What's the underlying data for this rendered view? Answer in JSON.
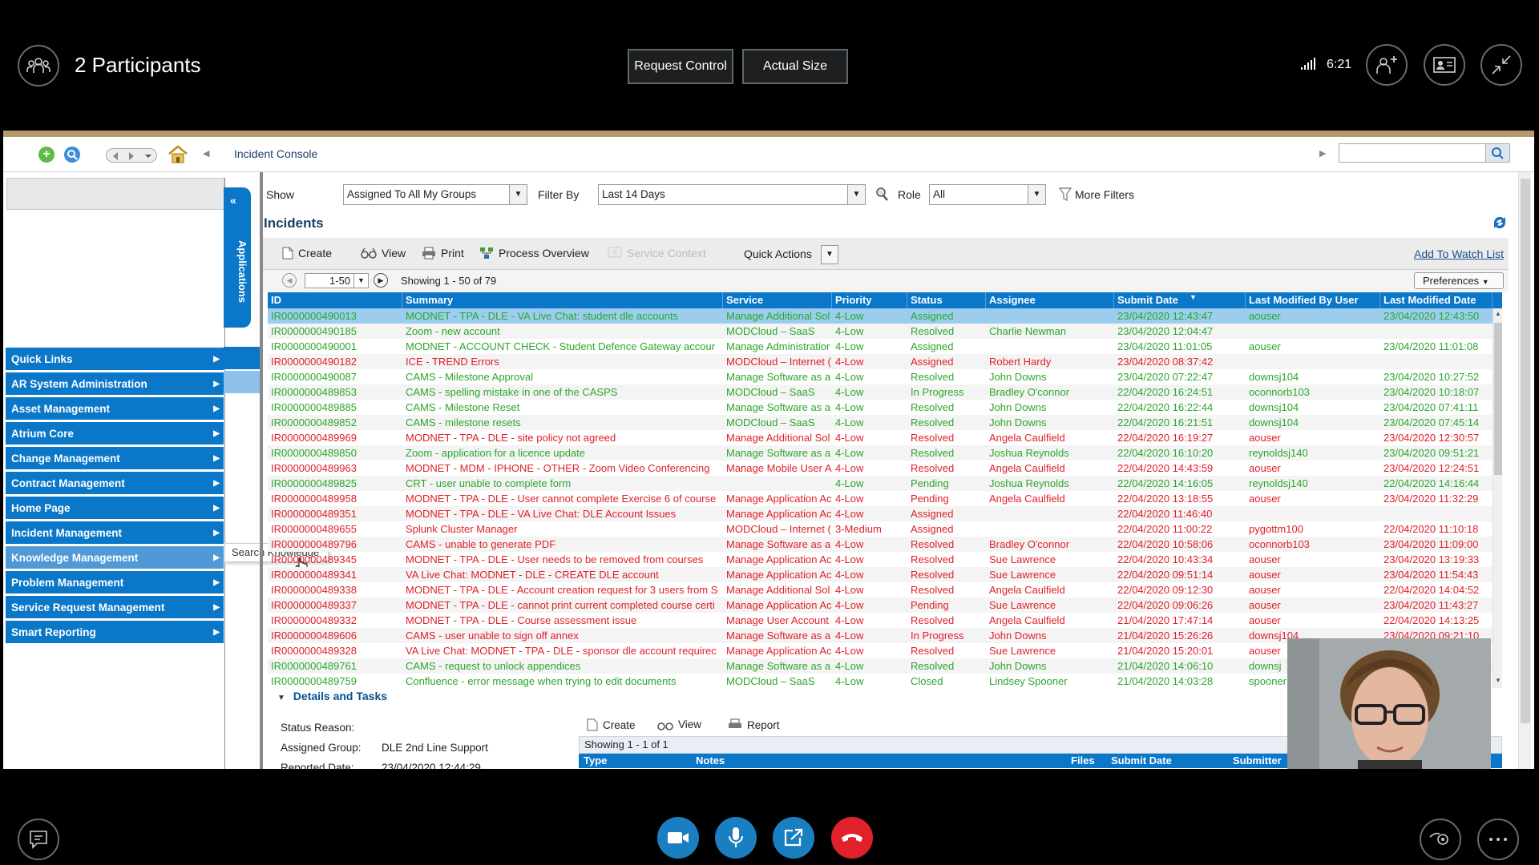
{
  "call": {
    "participants_label": "2 Participants",
    "request_control": "Request Control",
    "actual_size": "Actual Size",
    "time": "6:21"
  },
  "app": {
    "title": "Incident Console",
    "show_label": "Show",
    "show_value": "Assigned To All My Groups",
    "filter_by_label": "Filter By",
    "filter_by_value": "Last 14 Days",
    "role_label": "Role",
    "role_value": "All",
    "more_filters": "More Filters",
    "section_title": "Incidents",
    "add_to_watch": "Add To Watch List",
    "preferences": "Preferences",
    "page_range": "1-50",
    "showing": "Showing 1 - 50 of 79",
    "applications_tab": "Applications"
  },
  "toolbar": {
    "create": "Create",
    "view": "View",
    "print": "Print",
    "process_overview": "Process Overview",
    "service_context": "Service Context",
    "quick_actions": "Quick Actions"
  },
  "nav": {
    "items": [
      "Quick Links",
      "AR System Administration",
      "Asset Management",
      "Atrium Core",
      "Change Management",
      "Contract Management",
      "Home Page",
      "Incident Management",
      "Knowledge Management",
      "Problem Management",
      "Service Request Management",
      "Smart Reporting"
    ],
    "flyout": "Search Knowledge"
  },
  "grid": {
    "columns": [
      "ID",
      "Summary",
      "Service",
      "Priority",
      "Status",
      "Assignee",
      "Submit Date",
      "Last Modified By User",
      "Last Modified Date"
    ],
    "rows": [
      {
        "id": "IR0000000490013",
        "summary": "MODNET - TPA - DLE - VA Live Chat: student dle accounts",
        "service": "Manage Additional Sol",
        "priority": "4-Low",
        "status": "Assigned",
        "assignee": "",
        "submit": "23/04/2020 12:43:47",
        "modby": "aouser",
        "moddate": "23/04/2020 12:43:50",
        "color": "green"
      },
      {
        "id": "IR0000000490185",
        "summary": "Zoom - new account",
        "service": "MODCloud – SaaS",
        "priority": "4-Low",
        "status": "Resolved",
        "assignee": "Charlie Newman",
        "submit": "23/04/2020 12:04:47",
        "modby": "",
        "moddate": "",
        "color": "green"
      },
      {
        "id": "IR0000000490001",
        "summary": "MODNET - ACCOUNT CHECK - Student Defence Gateway accour",
        "service": "Manage Administratior",
        "priority": "4-Low",
        "status": "Assigned",
        "assignee": "",
        "submit": "23/04/2020 11:01:05",
        "modby": "aouser",
        "moddate": "23/04/2020 11:01:08",
        "color": "green"
      },
      {
        "id": "IR0000000490182",
        "summary": "ICE - TREND Errors",
        "service": "MODCloud – Internet (",
        "priority": "4-Low",
        "status": "Assigned",
        "assignee": "Robert Hardy",
        "submit": "23/04/2020 08:37:42",
        "modby": "",
        "moddate": "",
        "color": "red"
      },
      {
        "id": "IR0000000490087",
        "summary": "CAMS - Milestone Approval",
        "service": "Manage Software as a",
        "priority": "4-Low",
        "status": "Resolved",
        "assignee": "John Downs",
        "submit": "23/04/2020 07:22:47",
        "modby": "downsj104",
        "moddate": "23/04/2020 10:27:52",
        "color": "green"
      },
      {
        "id": "IR0000000489853",
        "summary": "CAMS - spelling mistake in one of the CASPS",
        "service": "MODCloud – SaaS",
        "priority": "4-Low",
        "status": "In Progress",
        "assignee": "Bradley O'connor",
        "submit": "22/04/2020 16:24:51",
        "modby": "oconnorb103",
        "moddate": "23/04/2020 10:18:07",
        "color": "green"
      },
      {
        "id": "IR0000000489885",
        "summary": "CAMS - Milestone Reset",
        "service": "Manage Software as a",
        "priority": "4-Low",
        "status": "Resolved",
        "assignee": "John Downs",
        "submit": "22/04/2020 16:22:44",
        "modby": "downsj104",
        "moddate": "23/04/2020 07:41:11",
        "color": "green"
      },
      {
        "id": "IR0000000489852",
        "summary": "CAMS - milestone resets",
        "service": "MODCloud – SaaS",
        "priority": "4-Low",
        "status": "Resolved",
        "assignee": "John Downs",
        "submit": "22/04/2020 16:21:51",
        "modby": "downsj104",
        "moddate": "23/04/2020 07:45:14",
        "color": "green"
      },
      {
        "id": "IR0000000489969",
        "summary": "MODNET - TPA - DLE - site policy not agreed",
        "service": "Manage Additional Sol",
        "priority": "4-Low",
        "status": "Resolved",
        "assignee": "Angela Caulfield",
        "submit": "22/04/2020 16:19:27",
        "modby": "aouser",
        "moddate": "23/04/2020 12:30:57",
        "color": "red"
      },
      {
        "id": "IR0000000489850",
        "summary": "Zoom - application for a licence update",
        "service": "Manage Software as a",
        "priority": "4-Low",
        "status": "Resolved",
        "assignee": "Joshua Reynolds",
        "submit": "22/04/2020 16:10:20",
        "modby": "reynoldsj140",
        "moddate": "23/04/2020 09:51:21",
        "color": "green"
      },
      {
        "id": "IR0000000489963",
        "summary": "MODNET - MDM - IPHONE - OTHER - Zoom Video Conferencing",
        "service": "Manage Mobile User A",
        "priority": "4-Low",
        "status": "Resolved",
        "assignee": "Angela Caulfield",
        "submit": "22/04/2020 14:43:59",
        "modby": "aouser",
        "moddate": "23/04/2020 12:24:51",
        "color": "red"
      },
      {
        "id": "IR0000000489825",
        "summary": "CRT - user unable to complete form",
        "service": "",
        "priority": "4-Low",
        "status": "Pending",
        "assignee": "Joshua Reynolds",
        "submit": "22/04/2020 14:16:05",
        "modby": "reynoldsj140",
        "moddate": "22/04/2020 14:16:44",
        "color": "green"
      },
      {
        "id": "IR0000000489958",
        "summary": "MODNET - TPA - DLE - User cannot complete Exercise 6 of course",
        "service": "Manage Application Ac",
        "priority": "4-Low",
        "status": "Pending",
        "assignee": "Angela Caulfield",
        "submit": "22/04/2020 13:18:55",
        "modby": "aouser",
        "moddate": "23/04/2020 11:32:29",
        "color": "red"
      },
      {
        "id": "IR0000000489351",
        "summary": "MODNET - TPA - DLE - VA Live Chat: DLE Account Issues",
        "service": "Manage Application Ac",
        "priority": "4-Low",
        "status": "Assigned",
        "assignee": "",
        "submit": "22/04/2020 11:46:40",
        "modby": "",
        "moddate": "",
        "color": "red"
      },
      {
        "id": "IR0000000489655",
        "summary": "Splunk Cluster Manager",
        "service": "MODCloud – Internet (",
        "priority": "3-Medium",
        "status": "Assigned",
        "assignee": "",
        "submit": "22/04/2020 11:00:22",
        "modby": "pygottm100",
        "moddate": "22/04/2020 11:10:18",
        "color": "red"
      },
      {
        "id": "IR0000000489796",
        "summary": "CAMS - unable to generate PDF",
        "service": "Manage Software as a",
        "priority": "4-Low",
        "status": "Resolved",
        "assignee": "Bradley O'connor",
        "submit": "22/04/2020 10:58:06",
        "modby": "oconnorb103",
        "moddate": "23/04/2020 11:09:00",
        "color": "red"
      },
      {
        "id": "IR0000000489345",
        "summary": "MODNET - TPA - DLE - User needs to be removed from courses",
        "service": "Manage Application Ac",
        "priority": "4-Low",
        "status": "Resolved",
        "assignee": "Sue Lawrence",
        "submit": "22/04/2020 10:43:34",
        "modby": "aouser",
        "moddate": "23/04/2020 13:19:33",
        "color": "red"
      },
      {
        "id": "IR0000000489341",
        "summary": "VA Live Chat: MODNET - DLE - CREATE DLE account",
        "service": "Manage Application Ac",
        "priority": "4-Low",
        "status": "Resolved",
        "assignee": "Sue Lawrence",
        "submit": "22/04/2020 09:51:14",
        "modby": "aouser",
        "moddate": "23/04/2020 11:54:43",
        "color": "red"
      },
      {
        "id": "IR0000000489338",
        "summary": "MODNET - TPA - DLE - Account creation request for 3 users from S",
        "service": "Manage Additional Sol",
        "priority": "4-Low",
        "status": "Resolved",
        "assignee": "Angela Caulfield",
        "submit": "22/04/2020 09:12:30",
        "modby": "aouser",
        "moddate": "22/04/2020 14:04:52",
        "color": "red"
      },
      {
        "id": "IR0000000489337",
        "summary": "MODNET - TPA - DLE - cannot print current completed course certi",
        "service": "Manage Application Ac",
        "priority": "4-Low",
        "status": "Pending",
        "assignee": "Sue Lawrence",
        "submit": "22/04/2020 09:06:26",
        "modby": "aouser",
        "moddate": "23/04/2020 11:43:27",
        "color": "red"
      },
      {
        "id": "IR0000000489332",
        "summary": "MODNET - TPA - DLE - Course assessment issue",
        "service": "Manage User Account",
        "priority": "4-Low",
        "status": "Resolved",
        "assignee": "Angela Caulfield",
        "submit": "21/04/2020 17:47:14",
        "modby": "aouser",
        "moddate": "22/04/2020 14:13:25",
        "color": "red"
      },
      {
        "id": "IR0000000489606",
        "summary": "CAMS - user unable to sign off annex",
        "service": "Manage Software as a",
        "priority": "4-Low",
        "status": "In Progress",
        "assignee": "John Downs",
        "submit": "21/04/2020 15:26:26",
        "modby": "downsj104",
        "moddate": "23/04/2020 09:21:10",
        "color": "red"
      },
      {
        "id": "IR0000000489328",
        "summary": "VA Live Chat: MODNET - TPA - DLE - sponsor dle account requirec",
        "service": "Manage Application Ac",
        "priority": "4-Low",
        "status": "Resolved",
        "assignee": "Sue Lawrence",
        "submit": "21/04/2020 15:20:01",
        "modby": "aouser",
        "moddate": "",
        "color": "red"
      },
      {
        "id": "IR0000000489761",
        "summary": "CAMS - request to unlock appendices",
        "service": "Manage Software as a",
        "priority": "4-Low",
        "status": "Resolved",
        "assignee": "John Downs",
        "submit": "21/04/2020 14:06:10",
        "modby": "downsj",
        "moddate": "",
        "color": "green"
      },
      {
        "id": "IR0000000489759",
        "summary": "Confluence - error message when trying to edit documents",
        "service": "MODCloud – SaaS",
        "priority": "4-Low",
        "status": "Closed",
        "assignee": "Lindsey Spooner",
        "submit": "21/04/2020 14:03:28",
        "modby": "spooner",
        "moddate": "",
        "color": "green"
      }
    ]
  },
  "details": {
    "header": "Details and Tasks",
    "status_reason_label": "Status Reason:",
    "assigned_group_label": "Assigned Group:",
    "assigned_group_value": "DLE 2nd Line Support",
    "reported_date_label": "Reported Date:",
    "reported_date_value": "23/04/2020 12:44:29",
    "create": "Create",
    "view": "View",
    "report": "Report",
    "showing": "Showing 1 - 1 of 1",
    "columns": [
      "Type",
      "Notes",
      "Files",
      "Submit Date",
      "Submitter"
    ]
  },
  "colors": {
    "brand_blue": "#0a77c9",
    "row_red": "#e0202a",
    "row_green": "#2ca62c",
    "selected_row": "#9ccdef",
    "hangup_red": "#e0202a"
  }
}
